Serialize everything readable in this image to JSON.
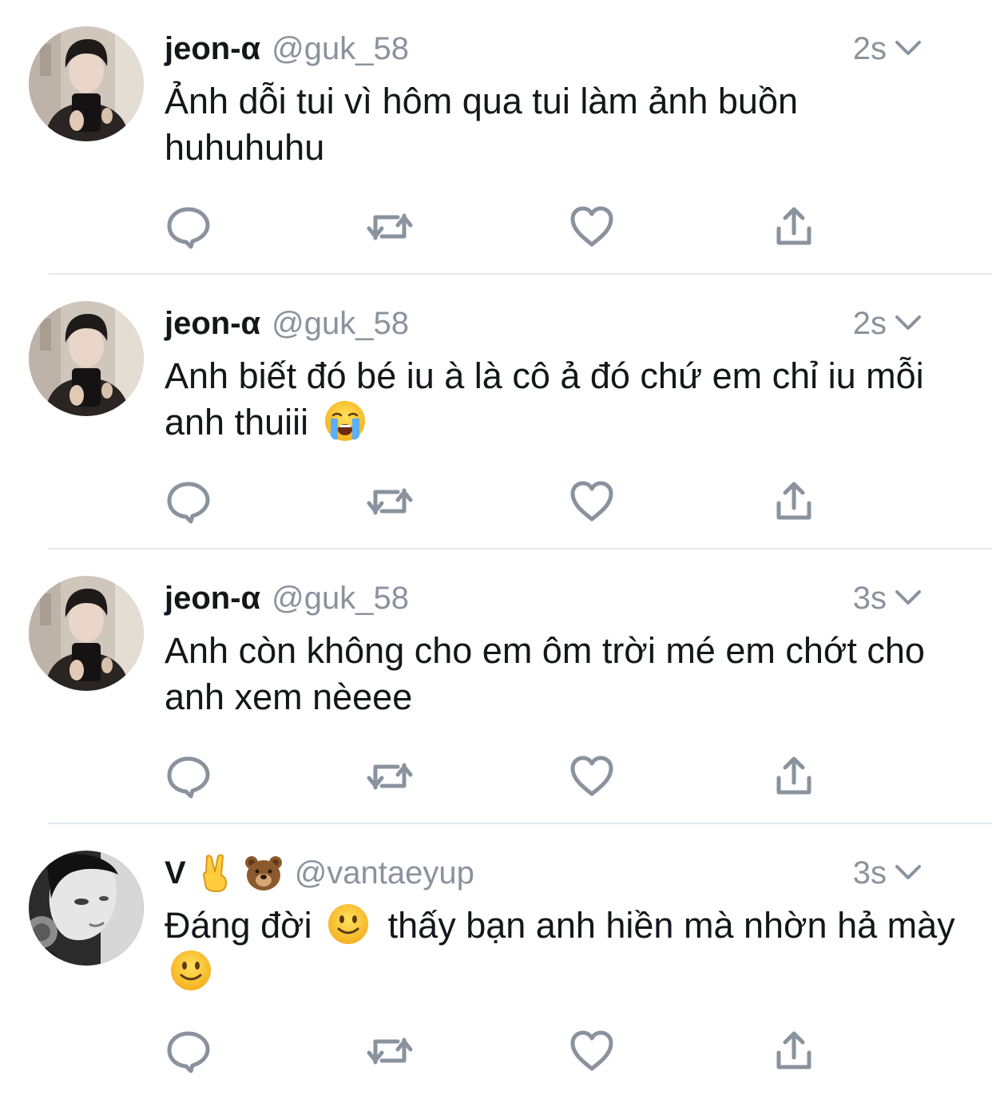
{
  "colors": {
    "text": "#14171a",
    "secondary": "#8a939d",
    "divider": "#e1e8ed",
    "icon": "#8a939d"
  },
  "tweets": [
    {
      "display_name": "jeon-α",
      "name_emojis": [],
      "handle": "@guk_58",
      "time": "2s",
      "text_parts": [
        "Ảnh dỗi tui vì hôm qua tui làm ảnh buồn huhuhuhu"
      ],
      "avatar": "avatar-jeon",
      "actions": [
        "reply-icon",
        "retweet-icon",
        "like-icon",
        "share-icon"
      ]
    },
    {
      "display_name": "jeon-α",
      "name_emojis": [],
      "handle": "@guk_58",
      "time": "2s",
      "text_parts": [
        "Anh biết đó bé iu à là cô ả đó chứ em chỉ iu mỗi anh thuiii"
      ],
      "text_emoji": "crying-face-emoji",
      "avatar": "avatar-jeon",
      "actions": [
        "reply-icon",
        "retweet-icon",
        "like-icon",
        "share-icon"
      ]
    },
    {
      "display_name": "jeon-α",
      "name_emojis": [],
      "handle": "@guk_58",
      "time": "3s",
      "text_parts": [
        "Anh còn không cho em ôm trời mé em chớt cho anh xem nèeee"
      ],
      "avatar": "avatar-jeon",
      "actions": [
        "reply-icon",
        "retweet-icon",
        "like-icon",
        "share-icon"
      ]
    },
    {
      "display_name": "V",
      "name_emojis": [
        "victory-hand-emoji",
        "bear-face-emoji"
      ],
      "handle": "@vantaeyup",
      "time": "3s",
      "text_parts": [
        "Đáng đời",
        "thấy bạn anh hiền mà nhờn hả mày"
      ],
      "text_emoji": "slightly-smiling-face-emoji",
      "avatar": "avatar-v",
      "actions": [
        "reply-icon",
        "retweet-icon",
        "like-icon",
        "share-icon"
      ]
    }
  ]
}
